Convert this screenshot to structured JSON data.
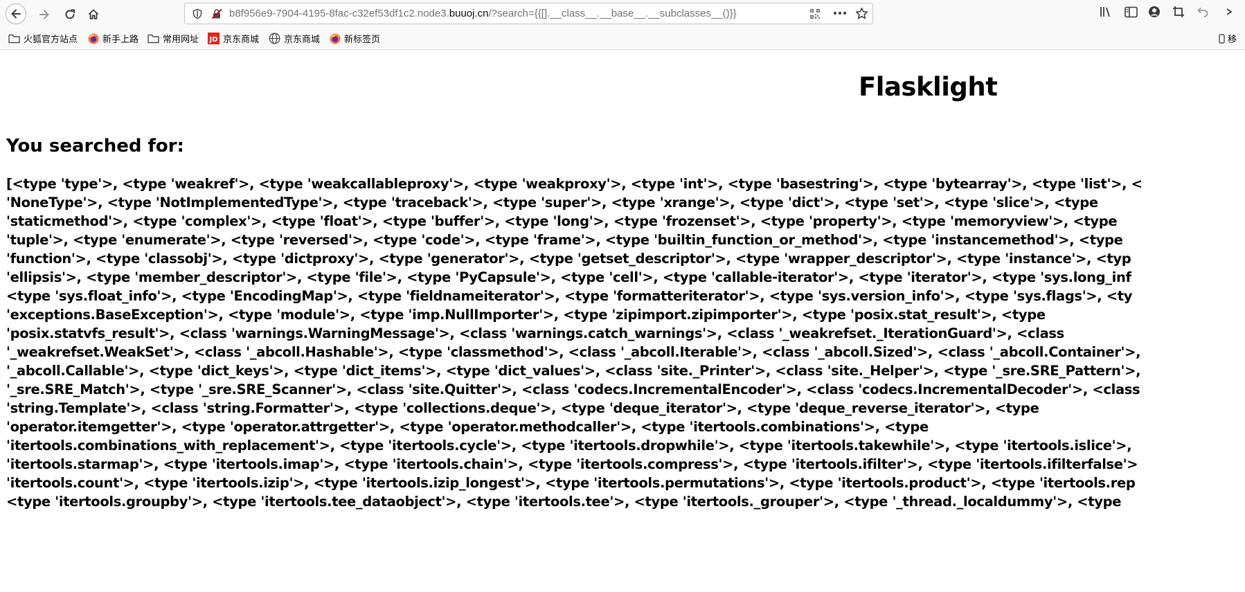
{
  "browser": {
    "url_prefix": "b8f956e9-7904-4195-8fac-c32ef53df1c2.node3.",
    "url_host": "buuoj.cn",
    "url_suffix": "/?search={{[].__class__.__base__.__subclasses__()}}",
    "icons": {
      "back": "back-arrow-icon",
      "forward": "forward-arrow-icon",
      "reload": "reload-icon",
      "home": "home-icon",
      "info": "info-shield-icon",
      "insecure": "insecure-lock-icon",
      "qr": "qr-code-icon",
      "more": "more-dots-icon",
      "bookmark": "star-icon",
      "library": "library-icon",
      "sidebar": "sidebar-icon",
      "account": "account-icon",
      "screenshot": "screenshot-icon",
      "undo": "undo-icon"
    }
  },
  "bookmarks": [
    {
      "label": "火狐官方站点",
      "icon": "folder-icon"
    },
    {
      "label": "新手上路",
      "icon": "firefox-icon"
    },
    {
      "label": "常用网址",
      "icon": "folder-icon"
    },
    {
      "label": "京东商城",
      "icon": "jd-icon"
    },
    {
      "label": "京东商城",
      "icon": "globe-icon"
    },
    {
      "label": "新标签页",
      "icon": "firefox-icon"
    }
  ],
  "bookmarks_overflow": "移",
  "page": {
    "title": "Flasklight",
    "heading": "You searched for:",
    "result_lines": [
      "[<type 'type'>, <type 'weakref'>, <type 'weakcallableproxy'>, <type 'weakproxy'>, <type 'int'>, <type 'basestring'>, <type 'bytearray'>, <type 'list'>, <",
      "'NoneType'>, <type 'NotImplementedType'>, <type 'traceback'>, <type 'super'>, <type 'xrange'>, <type 'dict'>, <type 'set'>, <type 'slice'>, <type",
      "'staticmethod'>, <type 'complex'>, <type 'float'>, <type 'buffer'>, <type 'long'>, <type 'frozenset'>, <type 'property'>, <type 'memoryview'>, <type",
      "'tuple'>, <type 'enumerate'>, <type 'reversed'>, <type 'code'>, <type 'frame'>, <type 'builtin_function_or_method'>, <type 'instancemethod'>, <type",
      "'function'>, <type 'classobj'>, <type 'dictproxy'>, <type 'generator'>, <type 'getset_descriptor'>, <type 'wrapper_descriptor'>, <type 'instance'>, <typ",
      "'ellipsis'>, <type 'member_descriptor'>, <type 'file'>, <type 'PyCapsule'>, <type 'cell'>, <type 'callable-iterator'>, <type 'iterator'>, <type 'sys.long_inf",
      "<type 'sys.float_info'>, <type 'EncodingMap'>, <type 'fieldnameiterator'>, <type 'formatteriterator'>, <type 'sys.version_info'>, <type 'sys.flags'>, <ty",
      "'exceptions.BaseException'>, <type 'module'>, <type 'imp.NullImporter'>, <type 'zipimport.zipimporter'>, <type 'posix.stat_result'>, <type",
      "'posix.statvfs_result'>, <class 'warnings.WarningMessage'>, <class 'warnings.catch_warnings'>, <class '_weakrefset._IterationGuard'>, <class",
      "'_weakrefset.WeakSet'>, <class '_abcoll.Hashable'>, <type 'classmethod'>, <class '_abcoll.Iterable'>, <class '_abcoll.Sized'>, <class '_abcoll.Container'>,",
      "'_abcoll.Callable'>, <type 'dict_keys'>, <type 'dict_items'>, <type 'dict_values'>, <class 'site._Printer'>, <class 'site._Helper'>, <type '_sre.SRE_Pattern'>,",
      "'_sre.SRE_Match'>, <type '_sre.SRE_Scanner'>, <class 'site.Quitter'>, <class 'codecs.IncrementalEncoder'>, <class 'codecs.IncrementalDecoder'>, <class",
      "'string.Template'>, <class 'string.Formatter'>, <type 'collections.deque'>, <type 'deque_iterator'>, <type 'deque_reverse_iterator'>, <type",
      "'operator.itemgetter'>, <type 'operator.attrgetter'>, <type 'operator.methodcaller'>, <type 'itertools.combinations'>, <type",
      "'itertools.combinations_with_replacement'>, <type 'itertools.cycle'>, <type 'itertools.dropwhile'>, <type 'itertools.takewhile'>, <type 'itertools.islice'>,",
      "'itertools.starmap'>, <type 'itertools.imap'>, <type 'itertools.chain'>, <type 'itertools.compress'>, <type 'itertools.ifilter'>, <type 'itertools.ifilterfalse'>",
      "'itertools.count'>, <type 'itertools.izip'>, <type 'itertools.izip_longest'>, <type 'itertools.permutations'>, <type 'itertools.product'>, <type 'itertools.rep",
      "<type 'itertools.groupby'>, <type 'itertools.tee_dataobject'>, <type 'itertools.tee'>, <type 'itertools._grouper'>, <type '_thread._localdummy'>, <type"
    ]
  }
}
